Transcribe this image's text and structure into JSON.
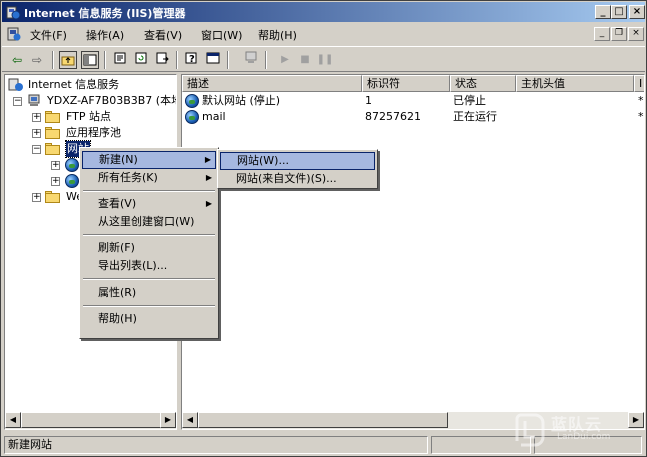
{
  "window": {
    "title": "Internet 信息服务 (IIS)管理器",
    "controls": {
      "minimize": "_",
      "maximize": "□",
      "close": "×"
    }
  },
  "menubar": {
    "items": [
      "文件(F)",
      "操作(A)",
      "查看(V)",
      "窗口(W)",
      "帮助(H)"
    ],
    "inner_controls": {
      "minimize": "_",
      "restore": "❐",
      "close": "×"
    }
  },
  "toolbar": {
    "icons": [
      "back-arrow-icon",
      "forward-arrow-icon",
      "up-folder-icon",
      "show-tree-icon",
      "properties-icon",
      "refresh-icon",
      "export-list-icon",
      "help-icon",
      "console-window-icon",
      "computer-icon",
      "play-icon",
      "stop-icon",
      "pause-icon"
    ]
  },
  "tree": {
    "root": "Internet 信息服务",
    "server": "YDXZ-AF7B03B3B7 (本地计",
    "nodes": [
      "FTP 站点",
      "应用程序池",
      "网站",
      "We"
    ],
    "selected": "网站"
  },
  "list": {
    "columns": [
      "描述",
      "标识符",
      "状态",
      "主机头值",
      "I"
    ],
    "rows": [
      {
        "description": "默认网站 (停止)",
        "id": "1",
        "status": "已停止",
        "host": "",
        "extra": "*"
      },
      {
        "description": "mail",
        "id": "87257621",
        "status": "正在运行",
        "host": "",
        "extra": "*"
      }
    ]
  },
  "context_menu": {
    "items": [
      {
        "label": "新建(N)",
        "has_submenu": true,
        "highlighted": true
      },
      {
        "label": "所有任务(K)",
        "has_submenu": true
      },
      {
        "label": "查看(V)",
        "has_submenu": true
      },
      {
        "label": "从这里创建窗口(W)"
      },
      {
        "label": "刷新(F)"
      },
      {
        "label": "导出列表(L)..."
      },
      {
        "label": "属性(R)"
      },
      {
        "label": "帮助(H)"
      }
    ]
  },
  "submenu": {
    "items": [
      {
        "label": "网站(W)...",
        "highlighted": true
      },
      {
        "label": "网站(来自文件)(S)..."
      }
    ]
  },
  "statusbar": {
    "text": "新建网站"
  },
  "watermark": {
    "brand": "蓝队云",
    "domain": "LanDui.com"
  },
  "colors": {
    "title_start": "#0a246a",
    "title_end": "#a6caf0",
    "face": "#d4d0c8",
    "highlight": "#0a246a",
    "menu_hover": "#a6b8e0"
  }
}
